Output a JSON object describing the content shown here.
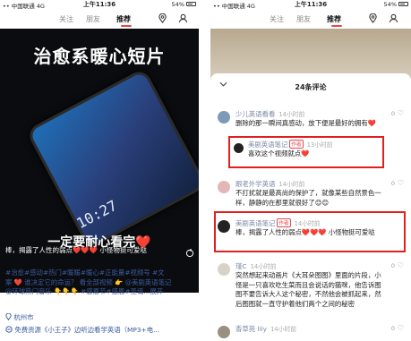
{
  "left": {
    "status": {
      "carrier": "•• 中国联通  4G",
      "time": "上午11:36",
      "battery": "54%"
    },
    "nav": {
      "tab1": "关注",
      "tab2": "朋友",
      "tab3": "推荐"
    },
    "video": {
      "title": "治愈系暖心短片",
      "clock": "10:27",
      "subtitle": "一定要耐心看完❤️",
      "caption": "棒，揭露了人性的弱点❤️❤️❤️ 小怪物挺可爱哒"
    },
    "note": {
      "line1": "#治愈#感动#热门#暖暖#暖心#正能量#视频号 #文",
      "line2": "案 ❤️ 谁决定它的命运？ 看全部视频 👉 @美剧英语笔记",
      "line3": "@环球热门音乐 👇👇👇 #感恩节#感恩#圣诞...展开",
      "location": "杭州市",
      "bottom": "免费资源《小王子》边听边看学英语（MP3+电..."
    }
  },
  "right": {
    "status": {
      "carrier": "•• 中国联通  4G",
      "time": "上午11:36",
      "battery": "54%"
    },
    "nav": {
      "tab1": "关注",
      "tab2": "朋友",
      "tab3": "推荐"
    },
    "sheet": {
      "title": "24条评论"
    },
    "comments": [
      {
        "name": "少儿英语看看",
        "time": "14小时前",
        "likes": "0",
        "body": "删除的那一瞬间真感动，放下便是最好的拥有❤️"
      },
      {
        "name": "美剧英语笔记",
        "tag": "作者",
        "time": "13小时前",
        "body": "喜欢这个视频就点❤️"
      },
      {
        "name": "跟老外学英语",
        "time": "14小时前",
        "likes": "0",
        "body": "不打扰就是最高尚的保护了，就像某些自然景色一样，静静的在那里就很好了😊😊"
      },
      {
        "name": "美剧英语笔记",
        "tag": "作者",
        "time": "14小时前",
        "body": "棒，揭露了人性的弱点❤️❤️❤️ 小怪物挺可爱哒"
      },
      {
        "name": "瑾C",
        "time": "14小时前",
        "likes": "0",
        "body": "突然想起来动画片《大耳朵图图》里面的片段，小怪是一只喜欢吃生菜而且会说话的猫咪，他告诉图图不要告诉大人这个秘密，不然他会被抓起来，然后图图就一直守护着他们两个之间的秘密"
      },
      {
        "name": "香草苑 lily",
        "time": "14小时前",
        "likes": "0",
        "body": ""
      }
    ]
  }
}
